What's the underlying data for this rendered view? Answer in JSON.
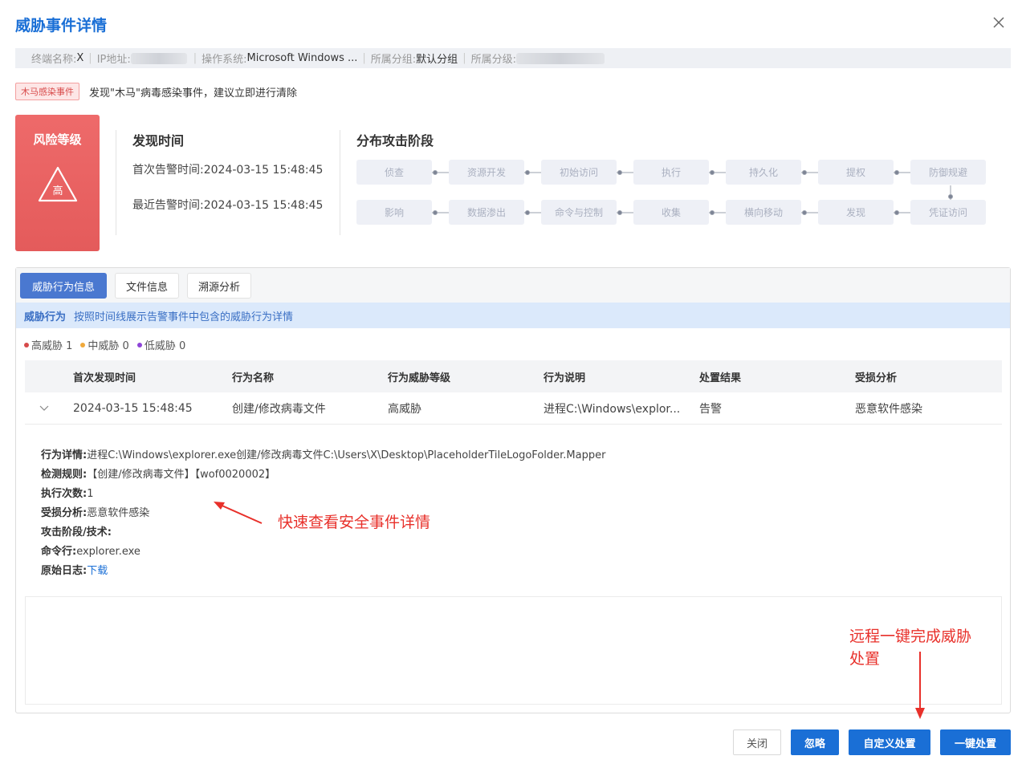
{
  "title": "威胁事件详情",
  "info": {
    "terminal_label": "终端名称:",
    "terminal_value": "X",
    "ip_label": "IP地址:",
    "os_label": "操作系统:",
    "os_value": "Microsoft Windows ...",
    "group_label": "所属分组:",
    "group_value": "默认分组",
    "level_label": "所属分级:"
  },
  "event": {
    "tag": "木马感染事件",
    "description": "发现\"木马\"病毒感染事件，建议立即进行清除"
  },
  "risk": {
    "title": "风险等级",
    "level": "高",
    "color": "#e45b5b"
  },
  "found_time": {
    "title": "发现时间",
    "first_label": "首次告警时间:",
    "first_value": "2024-03-15 15:48:45",
    "last_label": "最近告警时间:",
    "last_value": "2024-03-15 15:48:45"
  },
  "stages": {
    "title": "分布攻击阶段",
    "row1": [
      "侦查",
      "资源开发",
      "初始访问",
      "执行",
      "持久化",
      "提权",
      "防御规避"
    ],
    "row2": [
      "影响",
      "数据渗出",
      "命令与控制",
      "收集",
      "横向移动",
      "发现",
      "凭证访问"
    ]
  },
  "tabs": [
    "威胁行为信息",
    "文件信息",
    "溯源分析"
  ],
  "banner": {
    "title": "威胁行为",
    "desc": "按照时间线展示告警事件中包含的威胁行为详情"
  },
  "legend": [
    {
      "label": "高威胁 1",
      "color": "#d64a4a"
    },
    {
      "label": "中威胁 0",
      "color": "#f0a93b"
    },
    {
      "label": "低威胁 0",
      "color": "#8e44d8"
    }
  ],
  "table": {
    "headers": [
      "首次发现时间",
      "行为名称",
      "行为威胁等级",
      "行为说明",
      "处置结果",
      "受损分析"
    ],
    "row": [
      "2024-03-15 15:48:45",
      "创建/修改病毒文件",
      "高威胁",
      "进程C:\\Windows\\explor...",
      "告警",
      "恶意软件感染"
    ]
  },
  "detail": {
    "behavior_label": "行为详情:",
    "behavior_value": "进程C:\\Windows\\explorer.exe创建/修改病毒文件C:\\Users\\X\\Desktop\\PlaceholderTileLogoFolder.Mapper",
    "rule_label": "检测规则:",
    "rule_value": "【创建/修改病毒文件】【wof0020002】",
    "count_label": "执行次数:",
    "count_value": "1",
    "damage_label": "受损分析:",
    "damage_value": "恶意软件感染",
    "attack_label": "攻击阶段/技术:",
    "cmd_label": "命令行:",
    "cmd_value": "explorer.exe",
    "log_label": "原始日志:",
    "log_value": "下载"
  },
  "annotations": {
    "a1": "快速查看安全事件详情",
    "a2_line1": "远程一键完成威胁",
    "a2_line2": "处置"
  },
  "buttons": {
    "close": "关闭",
    "ignore": "忽略",
    "custom": "自定义处置",
    "one_click": "一键处置"
  }
}
